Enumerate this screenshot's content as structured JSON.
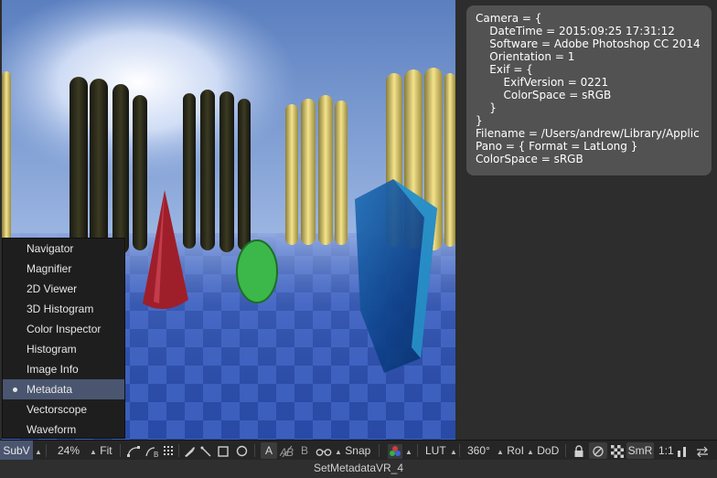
{
  "metadata_panel": {
    "lines": [
      "Camera = {",
      "    DateTime = 2015:09:25 17:31:12",
      "    Software = Adobe Photoshop CC 2014",
      "    Orientation = 1",
      "    Exif = {",
      "        ExifVersion = 0221",
      "        ColorSpace = sRGB",
      "    }",
      "}",
      "Filename = /Users/andrew/Library/Applic",
      "Pano = { Format = LatLong }",
      "ColorSpace = sRGB"
    ]
  },
  "subview_menu": {
    "items": [
      {
        "label": "Navigator",
        "selected": false
      },
      {
        "label": "Magnifier",
        "selected": false
      },
      {
        "label": "2D Viewer",
        "selected": false
      },
      {
        "label": "3D Histogram",
        "selected": false
      },
      {
        "label": "Color Inspector",
        "selected": false
      },
      {
        "label": "Histogram",
        "selected": false
      },
      {
        "label": "Image Info",
        "selected": false
      },
      {
        "label": "Metadata",
        "selected": true
      },
      {
        "label": "Vectorscope",
        "selected": false
      },
      {
        "label": "Waveform",
        "selected": false
      }
    ]
  },
  "toolbar": {
    "subview": "SubV",
    "zoom": "24%",
    "fit": "Fit",
    "snap": "Snap",
    "lut": "LUT",
    "vr": "360°",
    "roi": "RoI",
    "dod": "DoD",
    "smr": "SmR",
    "ratio": "1:1",
    "text_a": "A",
    "text_b": "B"
  },
  "status": {
    "node_name": "SetMetadataVR_4"
  },
  "icons": [
    "spline-icon",
    "bspline-icon",
    "grid-icon",
    "brush-icon",
    "wand-icon",
    "rectangle-icon",
    "circle-icon",
    "ab-compare-icon",
    "glasses-icon",
    "color-channels-icon",
    "lock-icon",
    "no-entry-icon",
    "checker-icon",
    "bars-icon",
    "swap-icon"
  ],
  "colors": {
    "selection": "#4a5670",
    "panel_bg": "#525252",
    "toolbar_bg": "#262626"
  }
}
